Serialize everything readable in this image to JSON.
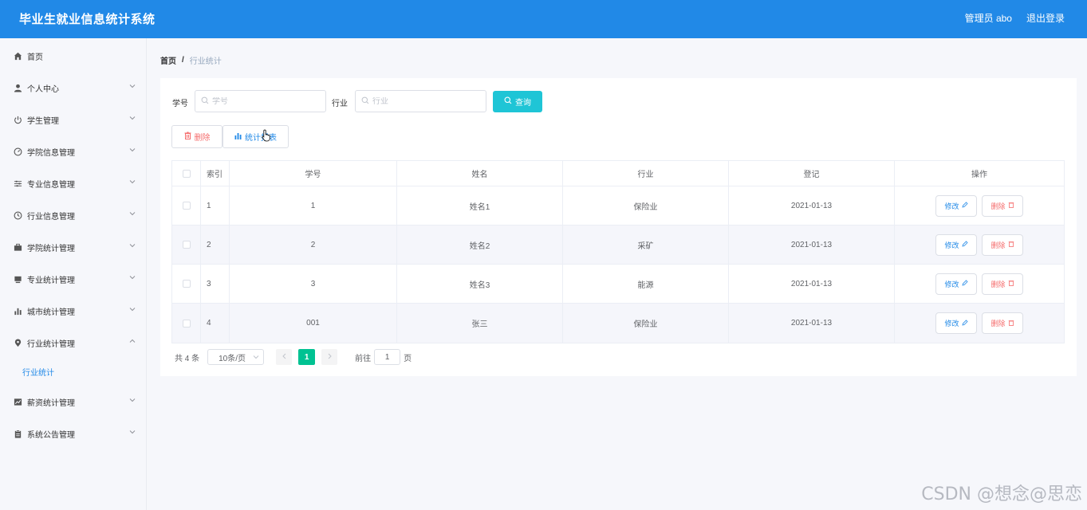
{
  "app": {
    "title": "毕业生就业信息统计系统"
  },
  "header": {
    "user_label": "管理员 abo",
    "logout_label": "退出登录"
  },
  "sidebar": {
    "items": [
      {
        "label": "首页",
        "icon": "home-icon"
      },
      {
        "label": "个人中心",
        "icon": "user-icon"
      },
      {
        "label": "学生管理",
        "icon": "power-icon"
      },
      {
        "label": "学院信息管理",
        "icon": "dashboard-icon"
      },
      {
        "label": "专业信息管理",
        "icon": "sliders-icon"
      },
      {
        "label": "行业信息管理",
        "icon": "clock-icon"
      },
      {
        "label": "学院统计管理",
        "icon": "briefcase-icon"
      },
      {
        "label": "专业统计管理",
        "icon": "monitor-icon"
      },
      {
        "label": "城市统计管理",
        "icon": "bar-chart-icon"
      },
      {
        "label": "行业统计管理",
        "icon": "location-icon"
      },
      {
        "label": "薪资统计管理",
        "icon": "line-chart-icon"
      },
      {
        "label": "系统公告管理",
        "icon": "clipboard-icon"
      }
    ],
    "sub_item": "行业统计"
  },
  "breadcrumb": {
    "home": "首页",
    "separator": "/",
    "current": "行业统计"
  },
  "search": {
    "student_id_label": "学号",
    "student_id_placeholder": "学号",
    "industry_label": "行业",
    "industry_placeholder": "行业",
    "query_button": "查询"
  },
  "actions": {
    "delete_label": "删除",
    "stat_report_label": "统计报表"
  },
  "table": {
    "headers": [
      "索引",
      "学号",
      "姓名",
      "行业",
      "登记",
      "操作"
    ],
    "rows": [
      {
        "index": "1",
        "student_id": "1",
        "name": "姓名1",
        "industry": "保险业",
        "date": "2021-01-13"
      },
      {
        "index": "2",
        "student_id": "2",
        "name": "姓名2",
        "industry": "采矿",
        "date": "2021-01-13"
      },
      {
        "index": "3",
        "student_id": "3",
        "name": "姓名3",
        "industry": "能源",
        "date": "2021-01-13"
      },
      {
        "index": "4",
        "student_id": "001",
        "name": "张三",
        "industry": "保险业",
        "date": "2021-01-13"
      }
    ],
    "edit_label": "修改",
    "delete_label": "删除"
  },
  "pagination": {
    "total_prefix": "共",
    "total": "4",
    "total_suffix": "条",
    "page_size": "10条/页",
    "current_page": "1",
    "goto_prefix": "前往",
    "goto_value": "1",
    "goto_suffix": "页"
  },
  "watermark": "CSDN @想念@思恋",
  "colors": {
    "header": "#2189e7",
    "accent_teal": "#1fc5d6",
    "page_active": "#00c292",
    "danger": "#f56c6c"
  }
}
